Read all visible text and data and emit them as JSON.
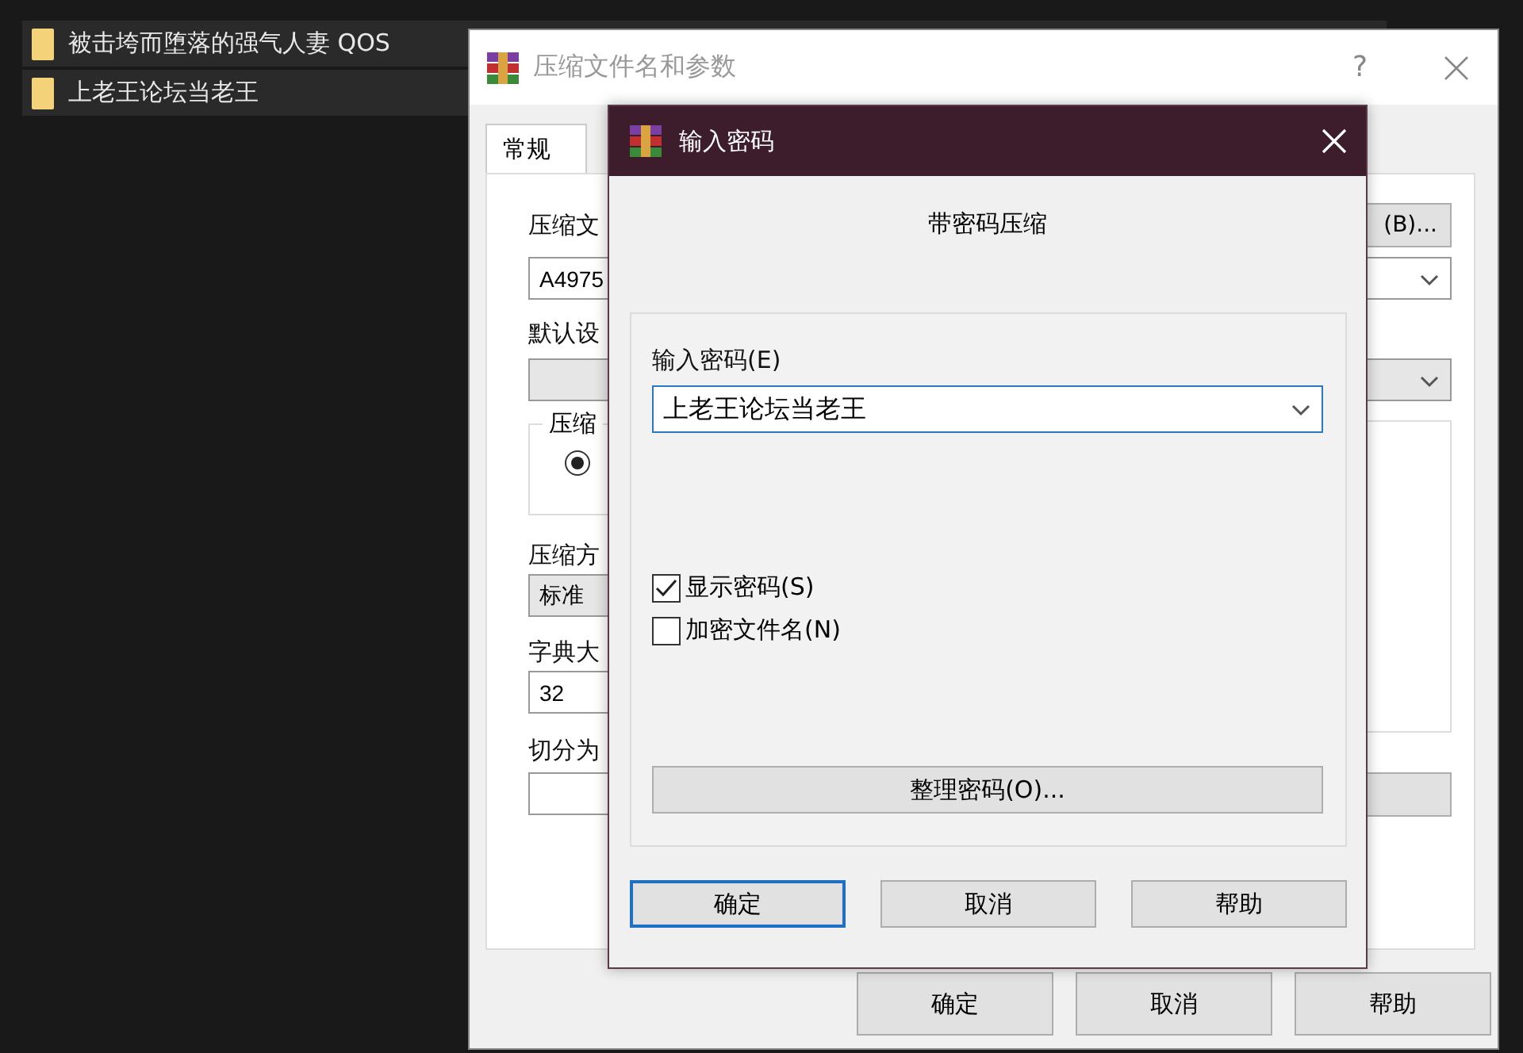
{
  "explorer": {
    "rows": [
      {
        "name": "被击垮而堕落的强气人妻 QOS"
      },
      {
        "name": "上老王论坛当老王"
      }
    ]
  },
  "back_dialog": {
    "title": "压缩文件名和参数",
    "help": "?",
    "tabs": [
      {
        "label": "常规",
        "selected": true
      }
    ],
    "archive_label": "压缩文",
    "browse_button": "(B)...",
    "archive_value": "A4975",
    "profile_label": "默认设",
    "group_label": "压缩",
    "radio": {
      "selected": true
    },
    "method_label": "压缩方",
    "method_value": "标准",
    "dict_label": "字典大",
    "dict_value": "32",
    "split_label": "切分为",
    "buttons": [
      "确定",
      "取消",
      "帮助"
    ]
  },
  "password_dialog": {
    "title": "输入密码",
    "heading": "带密码压缩",
    "password_label": "输入密码(E)",
    "password_value": "上老王论坛当老王",
    "options": [
      {
        "label": "显示密码(S)",
        "checked": true
      },
      {
        "label": "加密文件名(N)",
        "checked": false
      }
    ],
    "organize_button": "整理密码(O)...",
    "buttons": [
      {
        "label": "确定",
        "focused": true
      },
      {
        "label": "取消",
        "focused": false
      },
      {
        "label": "帮助",
        "focused": false
      }
    ]
  }
}
